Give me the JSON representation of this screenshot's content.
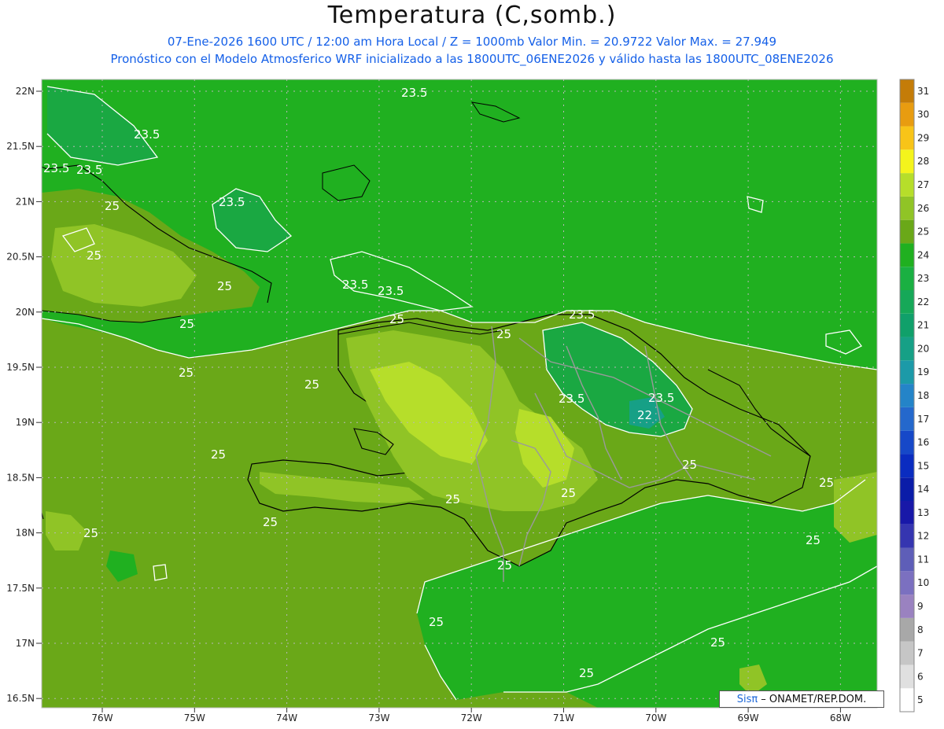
{
  "title": "Temperatura (C,somb.)",
  "subtitle1": "07-Ene-2026 1600 UTC / 12:00 am Hora Local / Z = 1000mb    Valor Min. = 20.9722  Valor Max. = 27.949",
  "subtitle2": "Pronóstico con el Modelo Atmosferico WRF inicializado a las 1800UTC_06ENE2026 y válido hasta las  1800UTC_08ENE2026",
  "credit": {
    "logo": "Sisπ",
    "text": "– ONAMET/REP.DOM."
  },
  "axes": {
    "lat_labels": [
      "22N",
      "21.5N",
      "21N",
      "20.5N",
      "20N",
      "19.5N",
      "19N",
      "18.5N",
      "18N",
      "17.5N",
      "17N",
      "16.5N"
    ],
    "lon_labels": [
      "76W",
      "75W",
      "74W",
      "73W",
      "72W",
      "71W",
      "70W",
      "69W",
      "68W"
    ],
    "lat_range": [
      16.5,
      22
    ],
    "lon_range": [
      -76.6,
      -67.6
    ],
    "grid": true
  },
  "colorbar": [
    {
      "label": "5",
      "color": "#ffffff"
    },
    {
      "label": "6",
      "color": "#e0e0e0"
    },
    {
      "label": "7",
      "color": "#c6c6c6"
    },
    {
      "label": "8",
      "color": "#a8a8a8"
    },
    {
      "label": "9",
      "color": "#9a82c0"
    },
    {
      "label": "10",
      "color": "#7b70c0"
    },
    {
      "label": "11",
      "color": "#5e5eb8"
    },
    {
      "label": "12",
      "color": "#3535b0"
    },
    {
      "label": "13",
      "color": "#1818a8"
    },
    {
      "label": "14",
      "color": "#0a1ca8"
    },
    {
      "label": "15",
      "color": "#0a2cc0"
    },
    {
      "label": "16",
      "color": "#1648c8"
    },
    {
      "label": "17",
      "color": "#2468cc"
    },
    {
      "label": "18",
      "color": "#2484c8"
    },
    {
      "label": "19",
      "color": "#1c9aa8"
    },
    {
      "label": "20",
      "color": "#16a086"
    },
    {
      "label": "21",
      "color": "#10a06a"
    },
    {
      "label": "22",
      "color": "#16a858"
    },
    {
      "label": "23",
      "color": "#1ab042"
    },
    {
      "label": "24",
      "color": "#20b020"
    },
    {
      "label": "25",
      "color": "#6aa818"
    },
    {
      "label": "26",
      "color": "#90c426"
    },
    {
      "label": "27",
      "color": "#b6de2a"
    },
    {
      "label": "28",
      "color": "#f4f41c"
    },
    {
      "label": "29",
      "color": "#f8c418"
    },
    {
      "label": "30",
      "color": "#e89c10"
    },
    {
      "label": "31",
      "color": "#c47c08"
    }
  ],
  "contours": {
    "labels": [
      "23.5",
      "23.5",
      "23.5",
      "23.5",
      "23.5",
      "23.5",
      "23.5",
      "23.5",
      "23.5",
      "23.5",
      "25",
      "25",
      "25",
      "25",
      "25",
      "25",
      "25",
      "25",
      "25",
      "25",
      "25",
      "25",
      "25",
      "25",
      "25",
      "25",
      "25",
      "25",
      "25",
      "25",
      "22"
    ]
  }
}
